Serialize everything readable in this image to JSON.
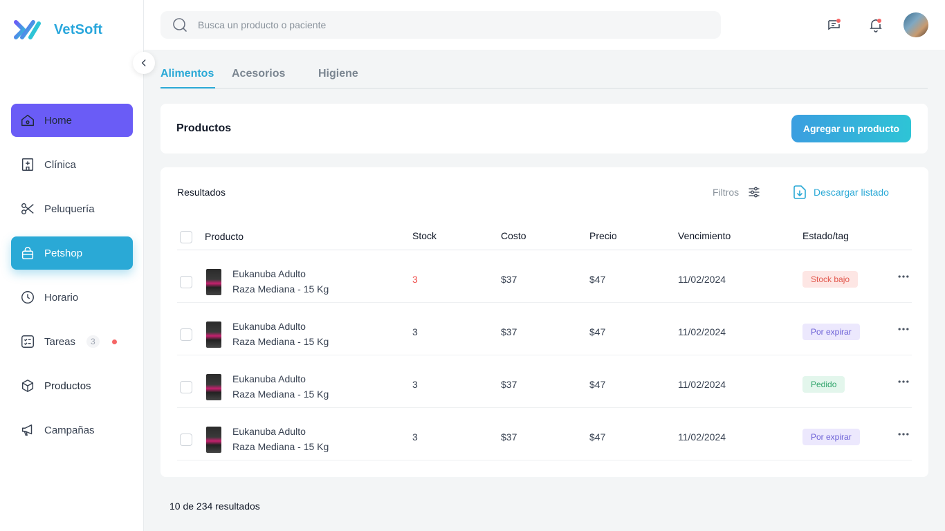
{
  "app": {
    "name": "VetSoft"
  },
  "colors": {
    "accent": "#2aa9d6",
    "home": "#6a5cf6",
    "danger": "#ef5350"
  },
  "sidebar": {
    "items": [
      {
        "label": "Home",
        "icon": "home-icon"
      },
      {
        "label": "Clínica",
        "icon": "clinic-icon"
      },
      {
        "label": "Peluquería",
        "icon": "scissors-icon"
      },
      {
        "label": "Petshop",
        "icon": "shopping-bag-icon"
      },
      {
        "label": "Horario",
        "icon": "clock-icon"
      },
      {
        "label": "Tareas",
        "icon": "checklist-icon",
        "count": "3"
      },
      {
        "label": "Productos",
        "icon": "box-icon"
      },
      {
        "label": "Campañas",
        "icon": "megaphone-icon"
      }
    ]
  },
  "search": {
    "placeholder": "Busca un producto o paciente"
  },
  "tabs": [
    {
      "label": "Alimentos",
      "active": true
    },
    {
      "label": "Acesorios"
    },
    {
      "label": "Higiene"
    }
  ],
  "products_header": {
    "title": "Productos",
    "add_button": "Agregar un producto"
  },
  "results": {
    "title": "Resultados",
    "filters_label": "Filtros",
    "download_label": "Descargar listado",
    "columns": {
      "product": "Producto",
      "stock": "Stock",
      "cost": "Costo",
      "price": "Precio",
      "expiry": "Vencimiento",
      "status": "Estado/tag"
    },
    "rows": [
      {
        "name1": "Eukanuba Adulto",
        "name2": "Raza Mediana - 15 Kg",
        "stock": "3",
        "cost": "$37",
        "price": "$47",
        "expiry": "11/02/2024",
        "tag": "Stock bajo",
        "tag_type": "low"
      },
      {
        "name1": "Eukanuba Adulto",
        "name2": "Raza Mediana - 15 Kg",
        "stock": "3",
        "cost": "$37",
        "price": "$47",
        "expiry": "11/02/2024",
        "tag": "Por expirar",
        "tag_type": "exp"
      },
      {
        "name1": "Eukanuba Adulto",
        "name2": "Raza Mediana - 15 Kg",
        "stock": "3",
        "cost": "$37",
        "price": "$47",
        "expiry": "11/02/2024",
        "tag": "Pedido",
        "tag_type": "ord"
      },
      {
        "name1": "Eukanuba Adulto",
        "name2": "Raza Mediana - 15 Kg",
        "stock": "3",
        "cost": "$37",
        "price": "$47",
        "expiry": "11/02/2024",
        "tag": "Por expirar",
        "tag_type": "exp"
      }
    ]
  },
  "pagination": {
    "summary": "10 de 234 resultados"
  }
}
